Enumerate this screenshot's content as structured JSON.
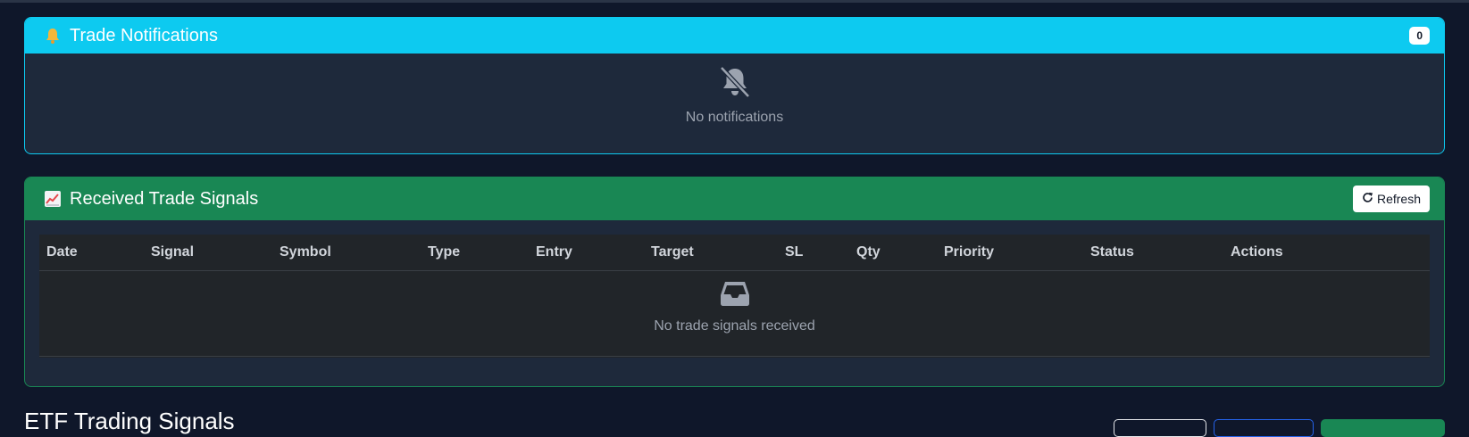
{
  "notifications": {
    "title": "Trade Notifications",
    "count": "0",
    "empty_text": "No notifications",
    "header_color": "#0dcaf0"
  },
  "signals": {
    "title": "Received Trade Signals",
    "refresh_label": "Refresh",
    "header_color": "#198754",
    "columns": [
      "Date",
      "Signal",
      "Symbol",
      "Type",
      "Entry",
      "Target",
      "SL",
      "Qty",
      "Priority",
      "Status",
      "Actions"
    ],
    "empty_text": "No trade signals received"
  },
  "next_section": {
    "title": "ETF Trading Signals"
  }
}
